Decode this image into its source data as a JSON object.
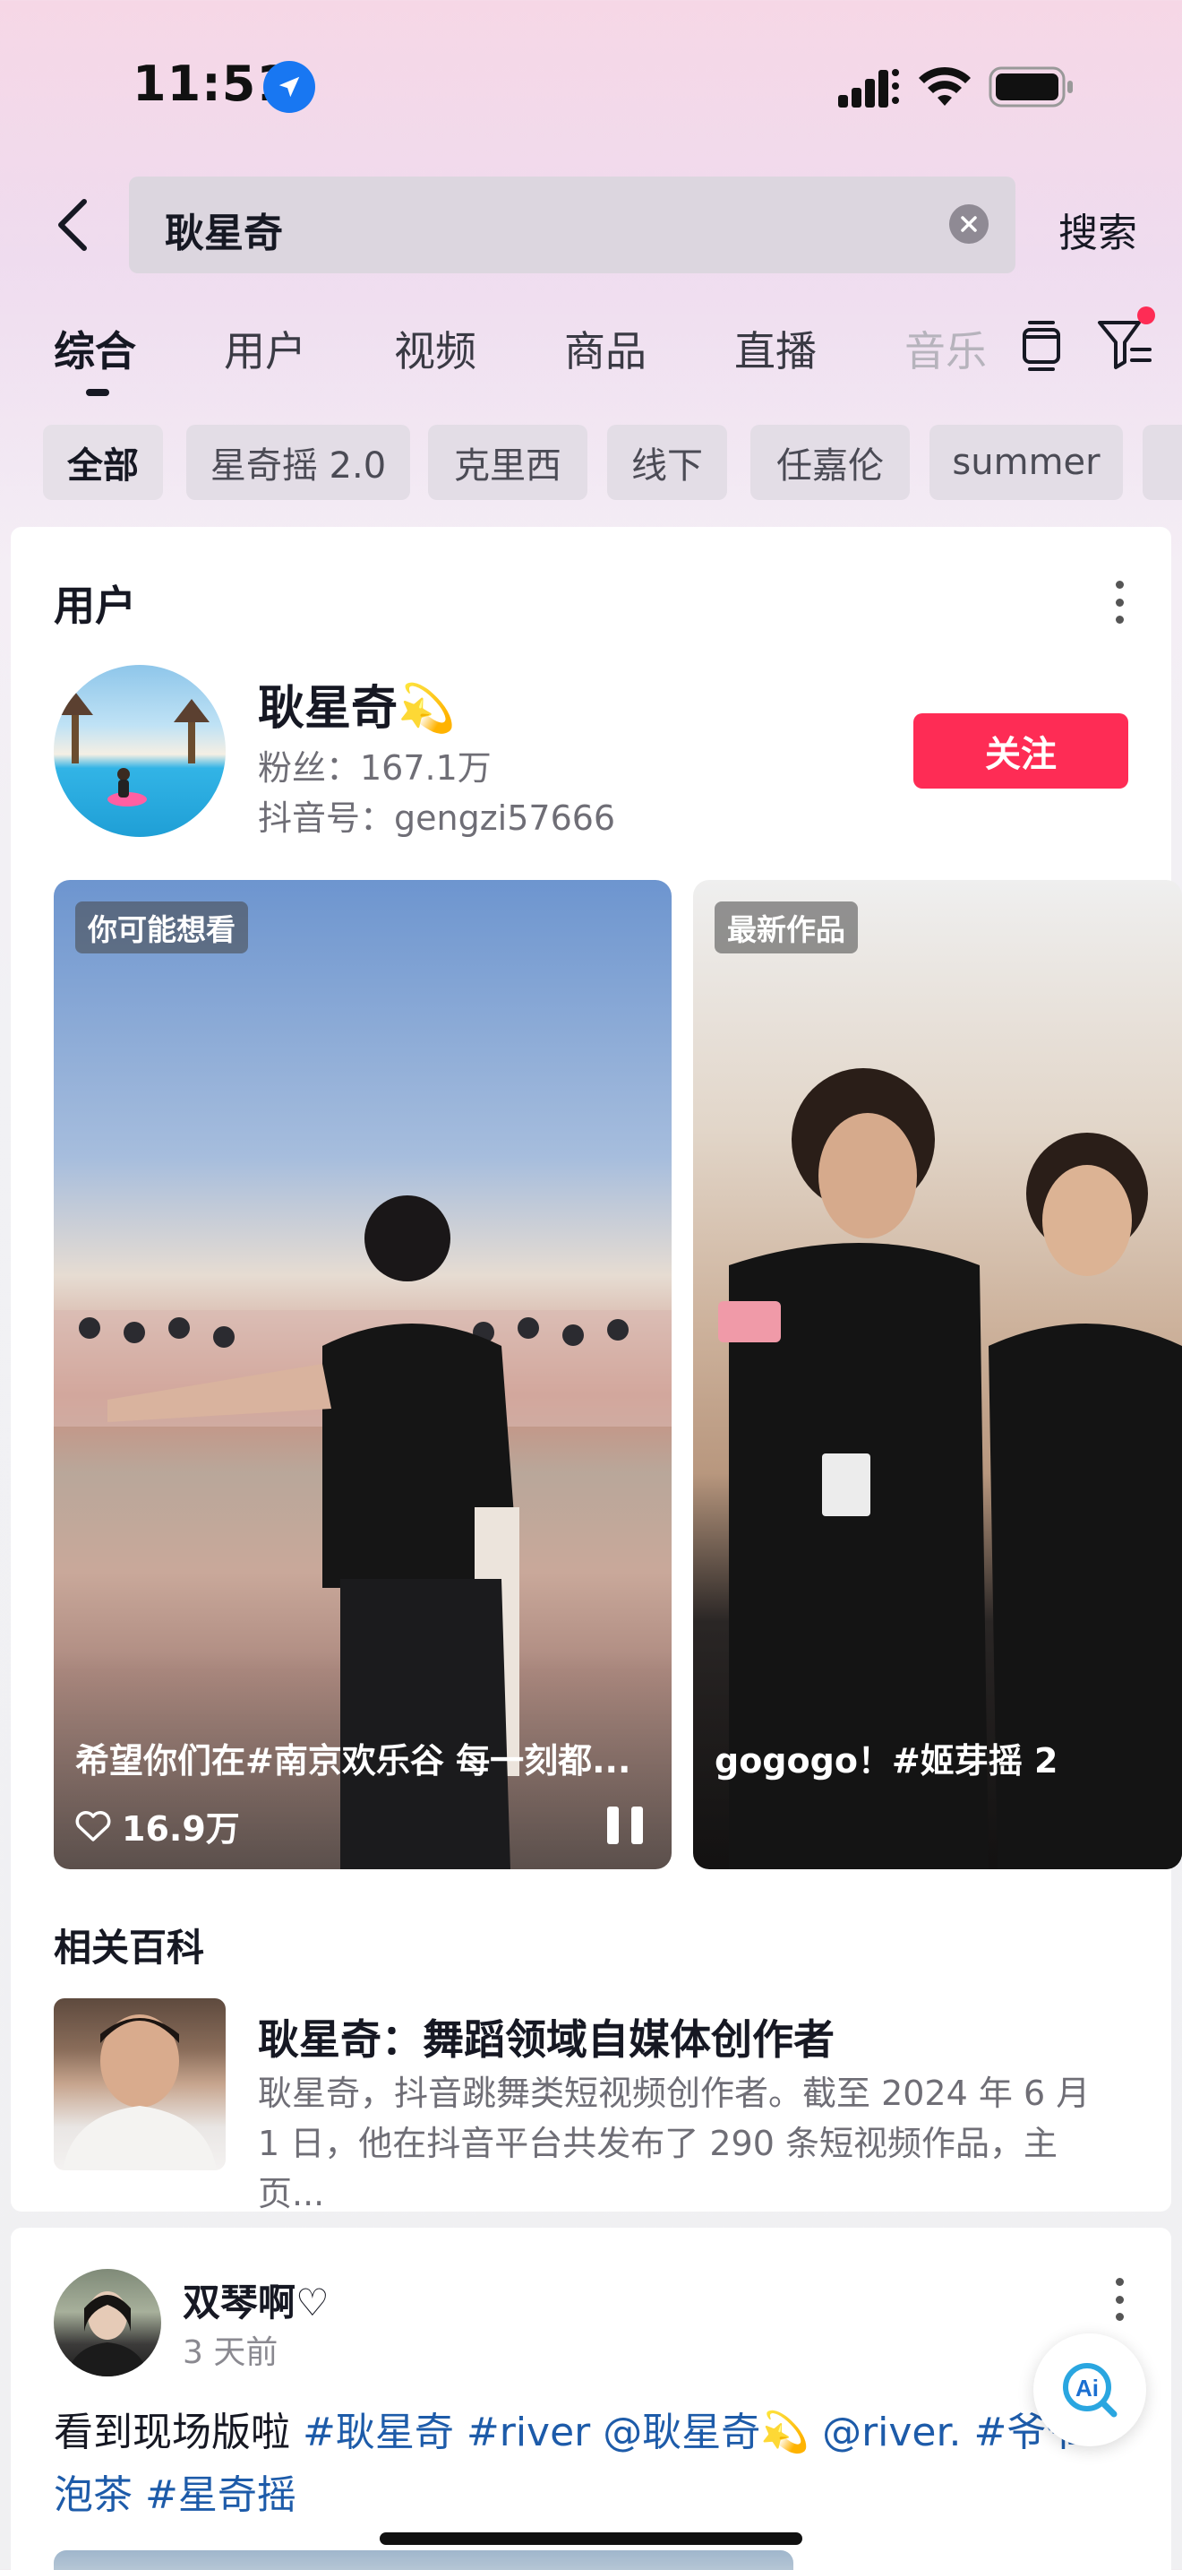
{
  "status_bar": {
    "time": "11:51"
  },
  "search": {
    "query": "耿星奇",
    "submit_label": "搜索"
  },
  "tabs": [
    {
      "label": "综合"
    },
    {
      "label": "用户"
    },
    {
      "label": "视频"
    },
    {
      "label": "商品"
    },
    {
      "label": "直播"
    },
    {
      "label": "音乐"
    }
  ],
  "chips": [
    "全部",
    "星奇摇 2.0",
    "克里西",
    "线下",
    "任嘉伦",
    "summer"
  ],
  "user_section": {
    "title": "用户",
    "name": "耿星奇",
    "name_emoji": "💫",
    "fans": "粉丝：167.1万",
    "douyin_id": "抖音号：gengzi57666",
    "follow_label": "关注"
  },
  "videos": [
    {
      "badge": "你可能想看",
      "caption": "希望你们在#南京欢乐谷 每一刻都...",
      "likes": "16.9万"
    },
    {
      "badge": "最新作品",
      "caption": "gogogo！#姬芽摇 2"
    }
  ],
  "wiki": {
    "section_title": "相关百科",
    "title": "耿星奇：舞蹈领域自媒体创作者",
    "desc": "耿星奇，抖音跳舞类短视频创作者。截至 2024 年 6 月 1 日，他在抖音平台共发布了 290 条短视频作品，主页..."
  },
  "post": {
    "user": "双琴啊♡",
    "time": "3 天前",
    "text_plain_1": "看到现场版啦 ",
    "tags_line1": [
      "#耿星奇",
      "#river",
      "@耿星奇💫",
      "@river.",
      "#爷爷"
    ],
    "line2_tags": [
      "泡茶",
      "#星奇摇"
    ]
  },
  "ai_button": {
    "label": "Ai"
  },
  "colors": {
    "accent": "#fe2c55",
    "link": "#1d5ba9"
  }
}
